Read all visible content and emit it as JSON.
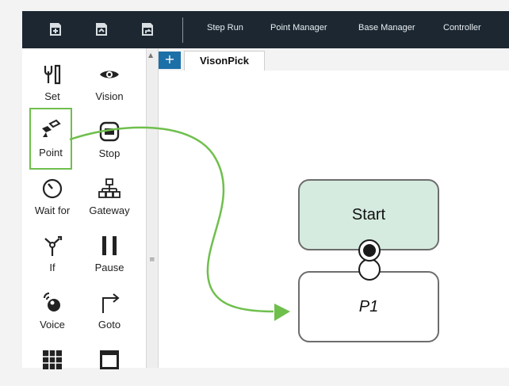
{
  "toolbar": {
    "icons": [
      "new-file-icon",
      "open-file-icon",
      "save-file-icon"
    ],
    "menus": [
      {
        "label": "Step Run"
      },
      {
        "label": "Point Manager"
      },
      {
        "label": "Base Manager"
      },
      {
        "label": "Controller"
      }
    ]
  },
  "palette": {
    "tools": [
      {
        "label": "Set",
        "icon": "set-icon"
      },
      {
        "label": "Vision",
        "icon": "vision-icon"
      },
      {
        "label": "Point",
        "icon": "point-icon",
        "selected": true
      },
      {
        "label": "Stop",
        "icon": "stop-icon"
      },
      {
        "label": "Wait for",
        "icon": "wait-for-icon"
      },
      {
        "label": "Gateway",
        "icon": "gateway-icon"
      },
      {
        "label": "If",
        "icon": "if-icon"
      },
      {
        "label": "Pause",
        "icon": "pause-icon"
      },
      {
        "label": "Voice",
        "icon": "voice-icon"
      },
      {
        "label": "Goto",
        "icon": "goto-icon"
      },
      {
        "label": "",
        "icon": "grid-icon"
      },
      {
        "label": "",
        "icon": "window-icon"
      }
    ]
  },
  "tabs": {
    "add": "+",
    "active": "VisonPick"
  },
  "flow": {
    "nodes": [
      {
        "label": "Start"
      },
      {
        "label": "P1"
      }
    ]
  },
  "colors": {
    "toolbar_bg": "#1c2731",
    "accent_blue": "#1d6fa8",
    "drag_green": "#6fbf4d",
    "start_fill": "#d5ebdf"
  }
}
